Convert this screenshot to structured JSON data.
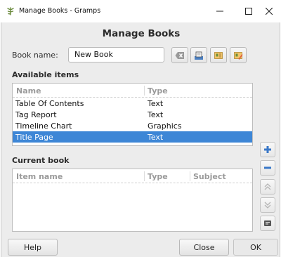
{
  "window": {
    "title": "Manage Books - Gramps"
  },
  "dialog": {
    "heading": "Manage Books",
    "book_name_label": "Book name:",
    "book_name_value": "New Book"
  },
  "toolbar": {
    "icons": [
      "clear-icon",
      "save-book-icon",
      "open-books-icon",
      "edit-books-icon"
    ]
  },
  "available": {
    "label": "Available items",
    "columns": [
      "Name",
      "Type"
    ],
    "rows": [
      {
        "name": "Table Of Contents",
        "type": "Text"
      },
      {
        "name": "Tag Report",
        "type": "Text"
      },
      {
        "name": "Timeline Chart",
        "type": "Graphics"
      },
      {
        "name": "Title Page",
        "type": "Text"
      }
    ],
    "selected_index": 3,
    "colors": {
      "selection": "#3d86d6"
    }
  },
  "current": {
    "label": "Current book",
    "columns": [
      "Item name",
      "Type",
      "Subject"
    ],
    "rows": []
  },
  "side_buttons": [
    "add-icon",
    "remove-icon",
    "move-up-icon",
    "move-down-icon",
    "setup-icon"
  ],
  "buttons": {
    "help": "Help",
    "close": "Close",
    "ok": "OK"
  }
}
